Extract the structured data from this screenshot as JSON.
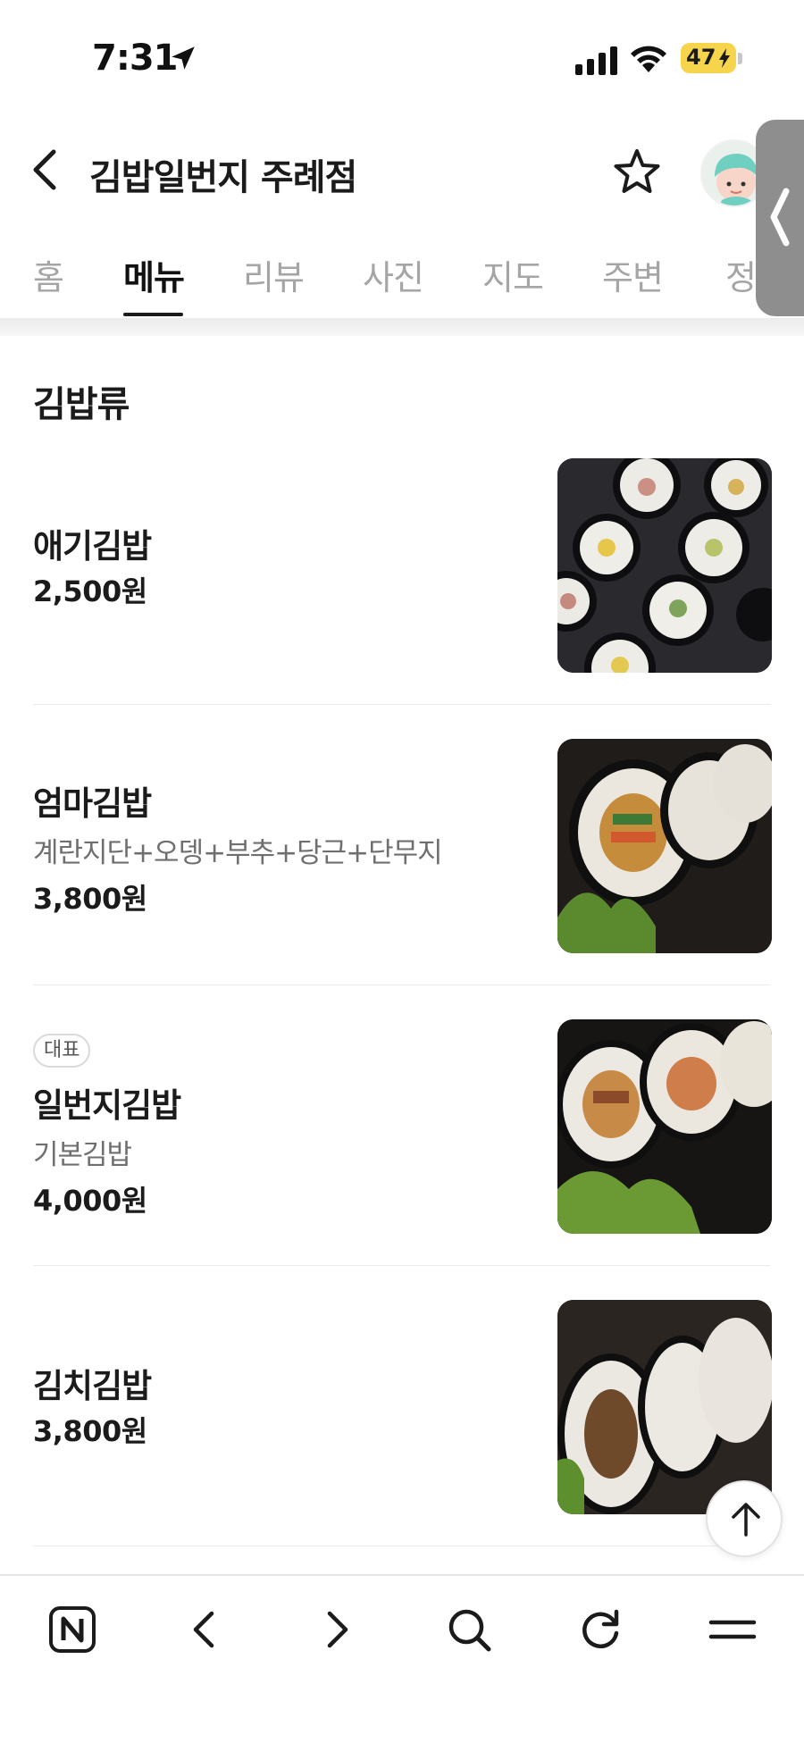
{
  "status_bar": {
    "time": "7:31",
    "battery": "47"
  },
  "header": {
    "title": "김밥일번지 주례점"
  },
  "tabs": [
    {
      "label": "홈"
    },
    {
      "label": "메뉴"
    },
    {
      "label": "리뷰"
    },
    {
      "label": "사진"
    },
    {
      "label": "지도"
    },
    {
      "label": "주변"
    },
    {
      "label": "정"
    }
  ],
  "active_tab": "메뉴",
  "section": {
    "title": "김밥류"
  },
  "menu_items": [
    {
      "name": "애기김밥",
      "price": "2,500원"
    },
    {
      "name": "엄마김밥",
      "description": "계란지단+오뎅+부추+당근+단무지",
      "price": "3,800원"
    },
    {
      "badge": "대표",
      "name": "일번지김밥",
      "description": "기본김밥",
      "price": "4,000원"
    },
    {
      "name": "김치김밥",
      "price": "3,800원"
    }
  ],
  "icons": {
    "back": "chevron-left-icon",
    "favorite": "star-icon",
    "scroll_top": "arrow-up-icon",
    "bottom_bar": [
      "naver-home-icon",
      "back-arrow-icon",
      "forward-arrow-icon",
      "search-icon",
      "refresh-icon",
      "menu-icon"
    ]
  },
  "colors": {
    "battery": "#f6d44b",
    "text": "#1b1b1b",
    "muted": "#6f6f6f",
    "inactive_tab": "#a5a5a5"
  }
}
